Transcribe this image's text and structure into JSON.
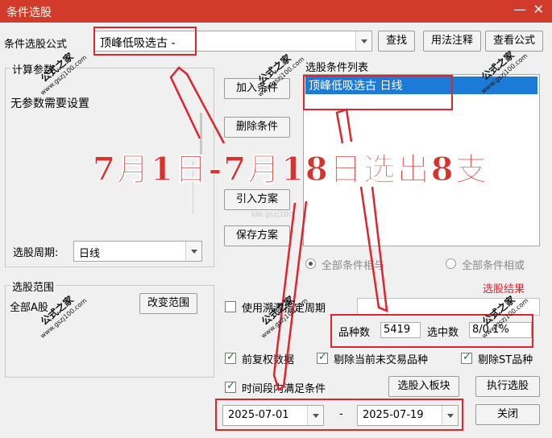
{
  "window": {
    "title": "条件选股",
    "minimize_glyph": "—",
    "close_glyph": "✕"
  },
  "top": {
    "formula_label": "条件选股公式",
    "formula_value": "顶峰低吸选古  -",
    "find_button": "查找",
    "usage_button": "用法注释",
    "view_formula_button": "查看公式"
  },
  "params": {
    "group_title": "计算参数",
    "text": "无参数需要设置"
  },
  "period": {
    "label": "选股周期:",
    "value": "日线"
  },
  "range": {
    "group_title": "选股范围",
    "text": "全部A股",
    "change_button": "改变范围"
  },
  "middle_buttons": {
    "add": "加入条件",
    "delete": "删除条件",
    "import": "引入方案",
    "save": "保存方案"
  },
  "cond_list": {
    "title": "选股条件列表",
    "items": [
      "顶峰低吸选古  日线"
    ]
  },
  "logic": {
    "and_label": "全部条件相与",
    "or_label": "全部条件相或",
    "result_link": "选股结果"
  },
  "custom_period": {
    "label": "使用溯源指定周期"
  },
  "stats": {
    "count_label": "品种数",
    "count_value": "5419",
    "selected_label": "选中数",
    "selected_value": "8/0.1%"
  },
  "options": {
    "fq_label": "前复权数据",
    "exclude_untraded_label": "剔除当前未交易品种",
    "exclude_st_label": "剔除ST品种"
  },
  "time": {
    "label": "时间段内满足条件",
    "start": "2025-07-01",
    "sep": "-",
    "end": "2025-07-19"
  },
  "bottom_buttons": {
    "to_block": "选股入板块",
    "execute": "执行选股",
    "close": "关闭"
  },
  "overlay": {
    "banner": "7月1日-7月18日选出8支",
    "watermark_title": "公式之家",
    "watermark_url": "www.gszj100.com",
    "faint_url": "Ide.gszj100"
  },
  "colors": {
    "titlebar": "#d23a2a",
    "selection": "#1c7bd6",
    "annotation": "#e0242c",
    "link": "#e0242c"
  }
}
